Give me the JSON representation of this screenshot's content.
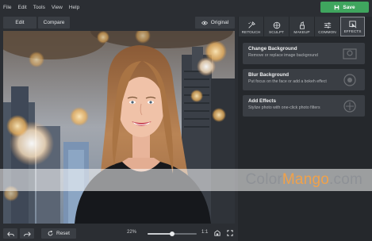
{
  "menu": {
    "items": [
      "File",
      "Edit",
      "Tools",
      "View",
      "Help"
    ]
  },
  "save_button": {
    "label": "Save"
  },
  "toolbar": {
    "edit_label": "Edit",
    "compare_label": "Compare",
    "original_label": "Original"
  },
  "bottom_bar": {
    "reset_label": "Reset",
    "zoom_label": "22%",
    "zoom_fraction": 0.5,
    "ratio_label": "1:1"
  },
  "tabs": [
    {
      "label": "RETOUCH",
      "icon": "retouch-icon"
    },
    {
      "label": "SCULPT",
      "icon": "sculpt-icon"
    },
    {
      "label": "MAKEUP",
      "icon": "makeup-icon"
    },
    {
      "label": "COMMON",
      "icon": "sliders-icon"
    },
    {
      "label": "EFFECTS",
      "icon": "effects-icon",
      "active": true
    }
  ],
  "cards": [
    {
      "title": "Change Background",
      "desc": "Remove or replace image background"
    },
    {
      "title": "Blur Background",
      "desc": "Put focus on the face or add a bokeh effect"
    },
    {
      "title": "Add Effects",
      "desc": "Stylize photo with one-click photo filters"
    }
  ],
  "watermark": {
    "part1": "Color",
    "part2": "Mango",
    "part3": ".com"
  },
  "colors": {
    "accent": "#3fa55e",
    "watermark_orange": "#f0a14a"
  }
}
